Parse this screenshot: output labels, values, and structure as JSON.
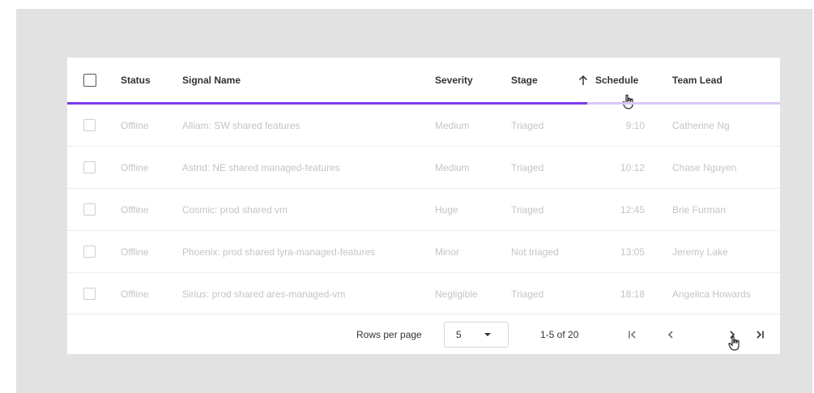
{
  "table": {
    "headers": {
      "status": "Status",
      "signal_name": "Signal Name",
      "severity": "Severity",
      "stage": "Stage",
      "schedule": "Schedule",
      "team_lead": "Team Lead"
    },
    "sort": {
      "column": "schedule",
      "direction": "ascending",
      "icon": "arrow-up-icon"
    },
    "loading_progress": 0.73,
    "rows": [
      {
        "status": "Offline",
        "signal_name": "Alliam: SW shared features",
        "severity": "Medium",
        "stage": "Triaged",
        "schedule": "9:10",
        "team_lead": "Catherine Ng"
      },
      {
        "status": "Offline",
        "signal_name": "Astrid: NE shared managed-features",
        "severity": "Medium",
        "stage": "Triaged",
        "schedule": "10:12",
        "team_lead": "Chase Nguyen"
      },
      {
        "status": "Offline",
        "signal_name": "Cosmic: prod shared vm",
        "severity": "Huge",
        "stage": "Triaged",
        "schedule": "12:45",
        "team_lead": "Brie Furman"
      },
      {
        "status": "Offline",
        "signal_name": "Phoenix: prod shared lyra-managed-features",
        "severity": "Minor",
        "stage": "Not triaged",
        "schedule": "13:05",
        "team_lead": "Jeremy Lake"
      },
      {
        "status": "Offline",
        "signal_name": "Sirius: prod shared ares-managed-vm",
        "severity": "Negligible",
        "stage": "Triaged",
        "schedule": "18:18",
        "team_lead": "Angelica Howards"
      }
    ]
  },
  "pagination": {
    "rows_per_page_label": "Rows per page",
    "rows_per_page_value": "5",
    "range_text": "1-5 of 20",
    "first_page_icon": "first-page-icon",
    "prev_page_icon": "chevron-left-icon",
    "next_page_icon": "chevron-right-icon",
    "last_page_icon": "last-page-icon"
  },
  "colors": {
    "accent": "#7c3aed",
    "accent_light": "#d8c8f6"
  }
}
